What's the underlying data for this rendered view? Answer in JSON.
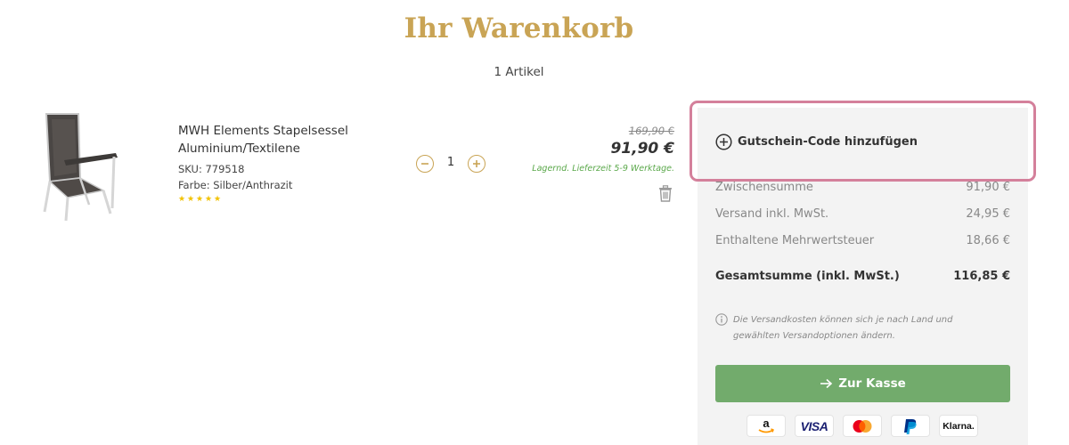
{
  "cart": {
    "title": "Ihr Warenkorb",
    "item_count": "1 Artikel"
  },
  "product": {
    "name": "MWH Elements Stapelsessel Aluminium/Textilene",
    "sku": "SKU: 779518",
    "color": "Farbe: Silber/Anthrazit",
    "rating_stars": 5,
    "quantity": "1",
    "old_price": "169,90 €",
    "price": "91,90 €",
    "stock": "Lagernd. Lieferzeit 5-9 Werktage.",
    "image_icon": "chair-image",
    "delete_icon": "trash-icon"
  },
  "summary": {
    "coupon_label": "Gutschein-Code hinzufügen",
    "rows": [
      {
        "label": "Zwischensumme",
        "value": "91,90 €"
      },
      {
        "label": "Versand inkl. MwSt.",
        "value": "24,95 €"
      },
      {
        "label": "Enthaltene Mehrwertsteuer",
        "value": "18,66 €"
      }
    ],
    "total": {
      "label": "Gesamtsumme (inkl. MwSt.)",
      "value": "116,85 €"
    },
    "note": "Die Versandkosten können sich je nach Land und gewählten Versandoptionen ändern.",
    "checkout_label": "Zur Kasse"
  },
  "payments": {
    "visa": "VISA",
    "klarna": "Klarna."
  },
  "colors": {
    "accent_gold": "#c9a455",
    "checkout_green": "#72ab6c",
    "highlight_pink": "#d4809b",
    "stock_green": "#5aa84a"
  }
}
